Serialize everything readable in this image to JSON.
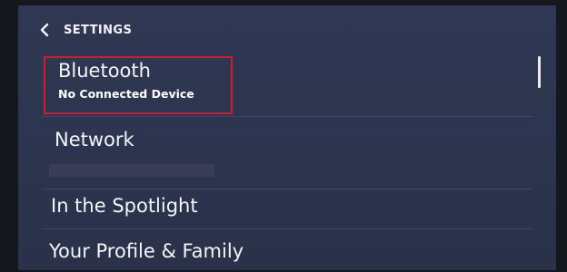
{
  "header": {
    "back_icon": "chevron-left-icon",
    "title": "SETTINGS"
  },
  "settings_items": [
    {
      "label": "Bluetooth",
      "sublabel": "No Connected Device",
      "highlighted": true
    },
    {
      "label": "Network",
      "sublabel": ""
    },
    {
      "label": "In the Spotlight"
    },
    {
      "label": "Your Profile & Family"
    }
  ],
  "colors": {
    "background": "#2d3550",
    "highlight": "#d61a2c",
    "text": "#f4f5f8"
  }
}
